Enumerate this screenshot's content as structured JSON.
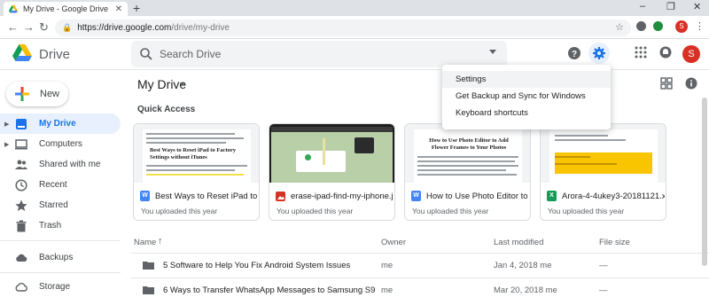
{
  "browser": {
    "tab_title": "My Drive - Google Drive",
    "new_tab": "+",
    "url_main": "https://drive.google.com",
    "url_path": "/drive/my-drive",
    "profile_initial": "S"
  },
  "header": {
    "brand": "Drive",
    "search_placeholder": "Search Drive",
    "avatar_initial": "S"
  },
  "settings_menu": {
    "items": [
      "Settings",
      "Get Backup and Sync for Windows",
      "Keyboard shortcuts"
    ]
  },
  "sidebar": {
    "new_label": "New",
    "items": [
      {
        "label": "My Drive",
        "icon": "my-drive-icon",
        "active": true
      },
      {
        "label": "Computers",
        "icon": "computers-icon"
      },
      {
        "label": "Shared with me",
        "icon": "shared-icon"
      },
      {
        "label": "Recent",
        "icon": "clock-icon"
      },
      {
        "label": "Starred",
        "icon": "star-icon"
      },
      {
        "label": "Trash",
        "icon": "trash-icon"
      },
      {
        "label": "Backups",
        "icon": "cloud-icon"
      },
      {
        "label": "Storage",
        "icon": "storage-icon"
      }
    ]
  },
  "main": {
    "title": "My Drive",
    "quick_access_label": "Quick Access",
    "quick_access": [
      {
        "name": "Best Ways to Reset iPad to Fa...",
        "sub": "You uploaded this year",
        "type": "W",
        "type_color": "#4285f4"
      },
      {
        "name": "erase-ipad-find-my-iphone.jpg",
        "sub": "You uploaded this year",
        "type": "image",
        "type_color": "#d93025"
      },
      {
        "name": "How to Use Photo Editor to A...",
        "sub": "You uploaded this year",
        "type": "W",
        "type_color": "#4285f4"
      },
      {
        "name": "Arora-4-4ukey3-20181121.xlsx",
        "sub": "You uploaded this year",
        "type": "X",
        "type_color": "#0f9d58"
      }
    ],
    "thumb_text": {
      "doc1_heading": "Best Ways to Reset iPad to Factory Settings without iTunes",
      "doc3_heading": "How to Use Photo Editor to Add Flower Frames to Your Photos"
    },
    "columns": {
      "name": "Name",
      "owner": "Owner",
      "modified": "Last modified",
      "size": "File size"
    },
    "files": [
      {
        "name": "5 Software to Help You Fix Android System Issues",
        "owner": "me",
        "modified": "Jan 4, 2018 me",
        "size": "—"
      },
      {
        "name": "6 Ways to Transfer WhatsApp Messages to Samsung S9",
        "owner": "me",
        "modified": "Mar 20, 2018 me",
        "size": "—"
      }
    ]
  },
  "colors": {
    "accent": "#1a73e8",
    "active_bg": "#e8f0fe",
    "avatar": "#d93025"
  }
}
